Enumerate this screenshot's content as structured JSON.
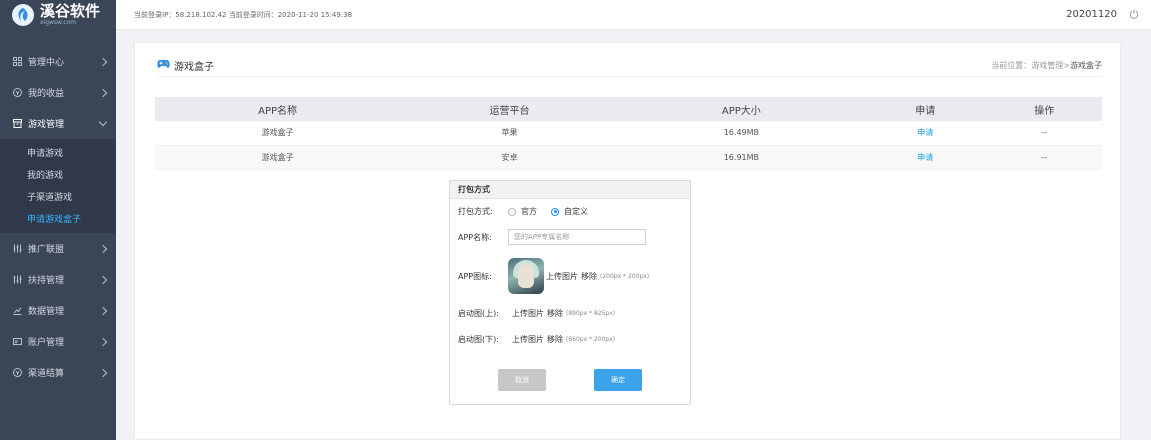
{
  "brand": {
    "title": "溪谷软件",
    "subtitle": "xigwsw.com"
  },
  "sidebar": {
    "items": [
      {
        "label": "管理中心"
      },
      {
        "label": "我的收益"
      },
      {
        "label": "游戏管理"
      },
      {
        "label": "推广联盟"
      },
      {
        "label": "扶持管理"
      },
      {
        "label": "数据管理"
      },
      {
        "label": "账户管理"
      },
      {
        "label": "渠道结算"
      }
    ],
    "sub_items": [
      {
        "label": "申请游戏"
      },
      {
        "label": "我的游戏"
      },
      {
        "label": "子渠道游戏"
      },
      {
        "label": "申请游戏盒子"
      }
    ]
  },
  "topbar": {
    "login_info": "当前登录IP：58.218.102.42 当前登录时间：2020-11-20 15:49:38",
    "date": "20201120"
  },
  "page": {
    "title": "游戏盒子",
    "breadcrumb_prefix": "当前位置：游戏管理>",
    "breadcrumb_current": "游戏盒子"
  },
  "table": {
    "headers": [
      "APP名称",
      "运营平台",
      "APP大小",
      "申请",
      "操作"
    ],
    "rows": [
      {
        "name": "游戏盒子",
        "platform": "苹果",
        "size": "16.49MB",
        "apply": "申请",
        "ops": "--"
      },
      {
        "name": "游戏盒子",
        "platform": "安卓",
        "size": "16.91MB",
        "apply": "申请",
        "ops": "--"
      }
    ]
  },
  "dialog": {
    "title": "打包方式",
    "pack_label": "打包方式:",
    "option_official": "官方",
    "option_custom": "自定义",
    "selected": "自定义",
    "name_label": "APP名称:",
    "name_placeholder": "您的APP专属名称",
    "icon_label": "APP图标:",
    "icon_upload": "上传图片",
    "icon_remove": "移除",
    "icon_size": "(200px * 200px)",
    "splash_top_label": "启动图(上):",
    "splash_top_upload": "上传图片",
    "splash_top_remove": "移除",
    "splash_top_size": "(890px * 825px)",
    "splash_bottom_label": "启动图(下):",
    "splash_bottom_upload": "上传图片",
    "splash_bottom_remove": "移除",
    "splash_bottom_size": "(660px * 200px)",
    "cancel": "取消",
    "confirm": "确定"
  },
  "colors": {
    "sidebar_bg": "#3a4557",
    "accent": "#36b7ff",
    "confirm": "#3aa3ea",
    "link": "#1a9fe0"
  },
  "icons": {
    "logo": "xigu-logo-icon",
    "power": "power-icon",
    "gamepad": "gamepad-icon",
    "chevron_right": "chevron-right-icon",
    "chevron_down": "chevron-down-icon"
  }
}
